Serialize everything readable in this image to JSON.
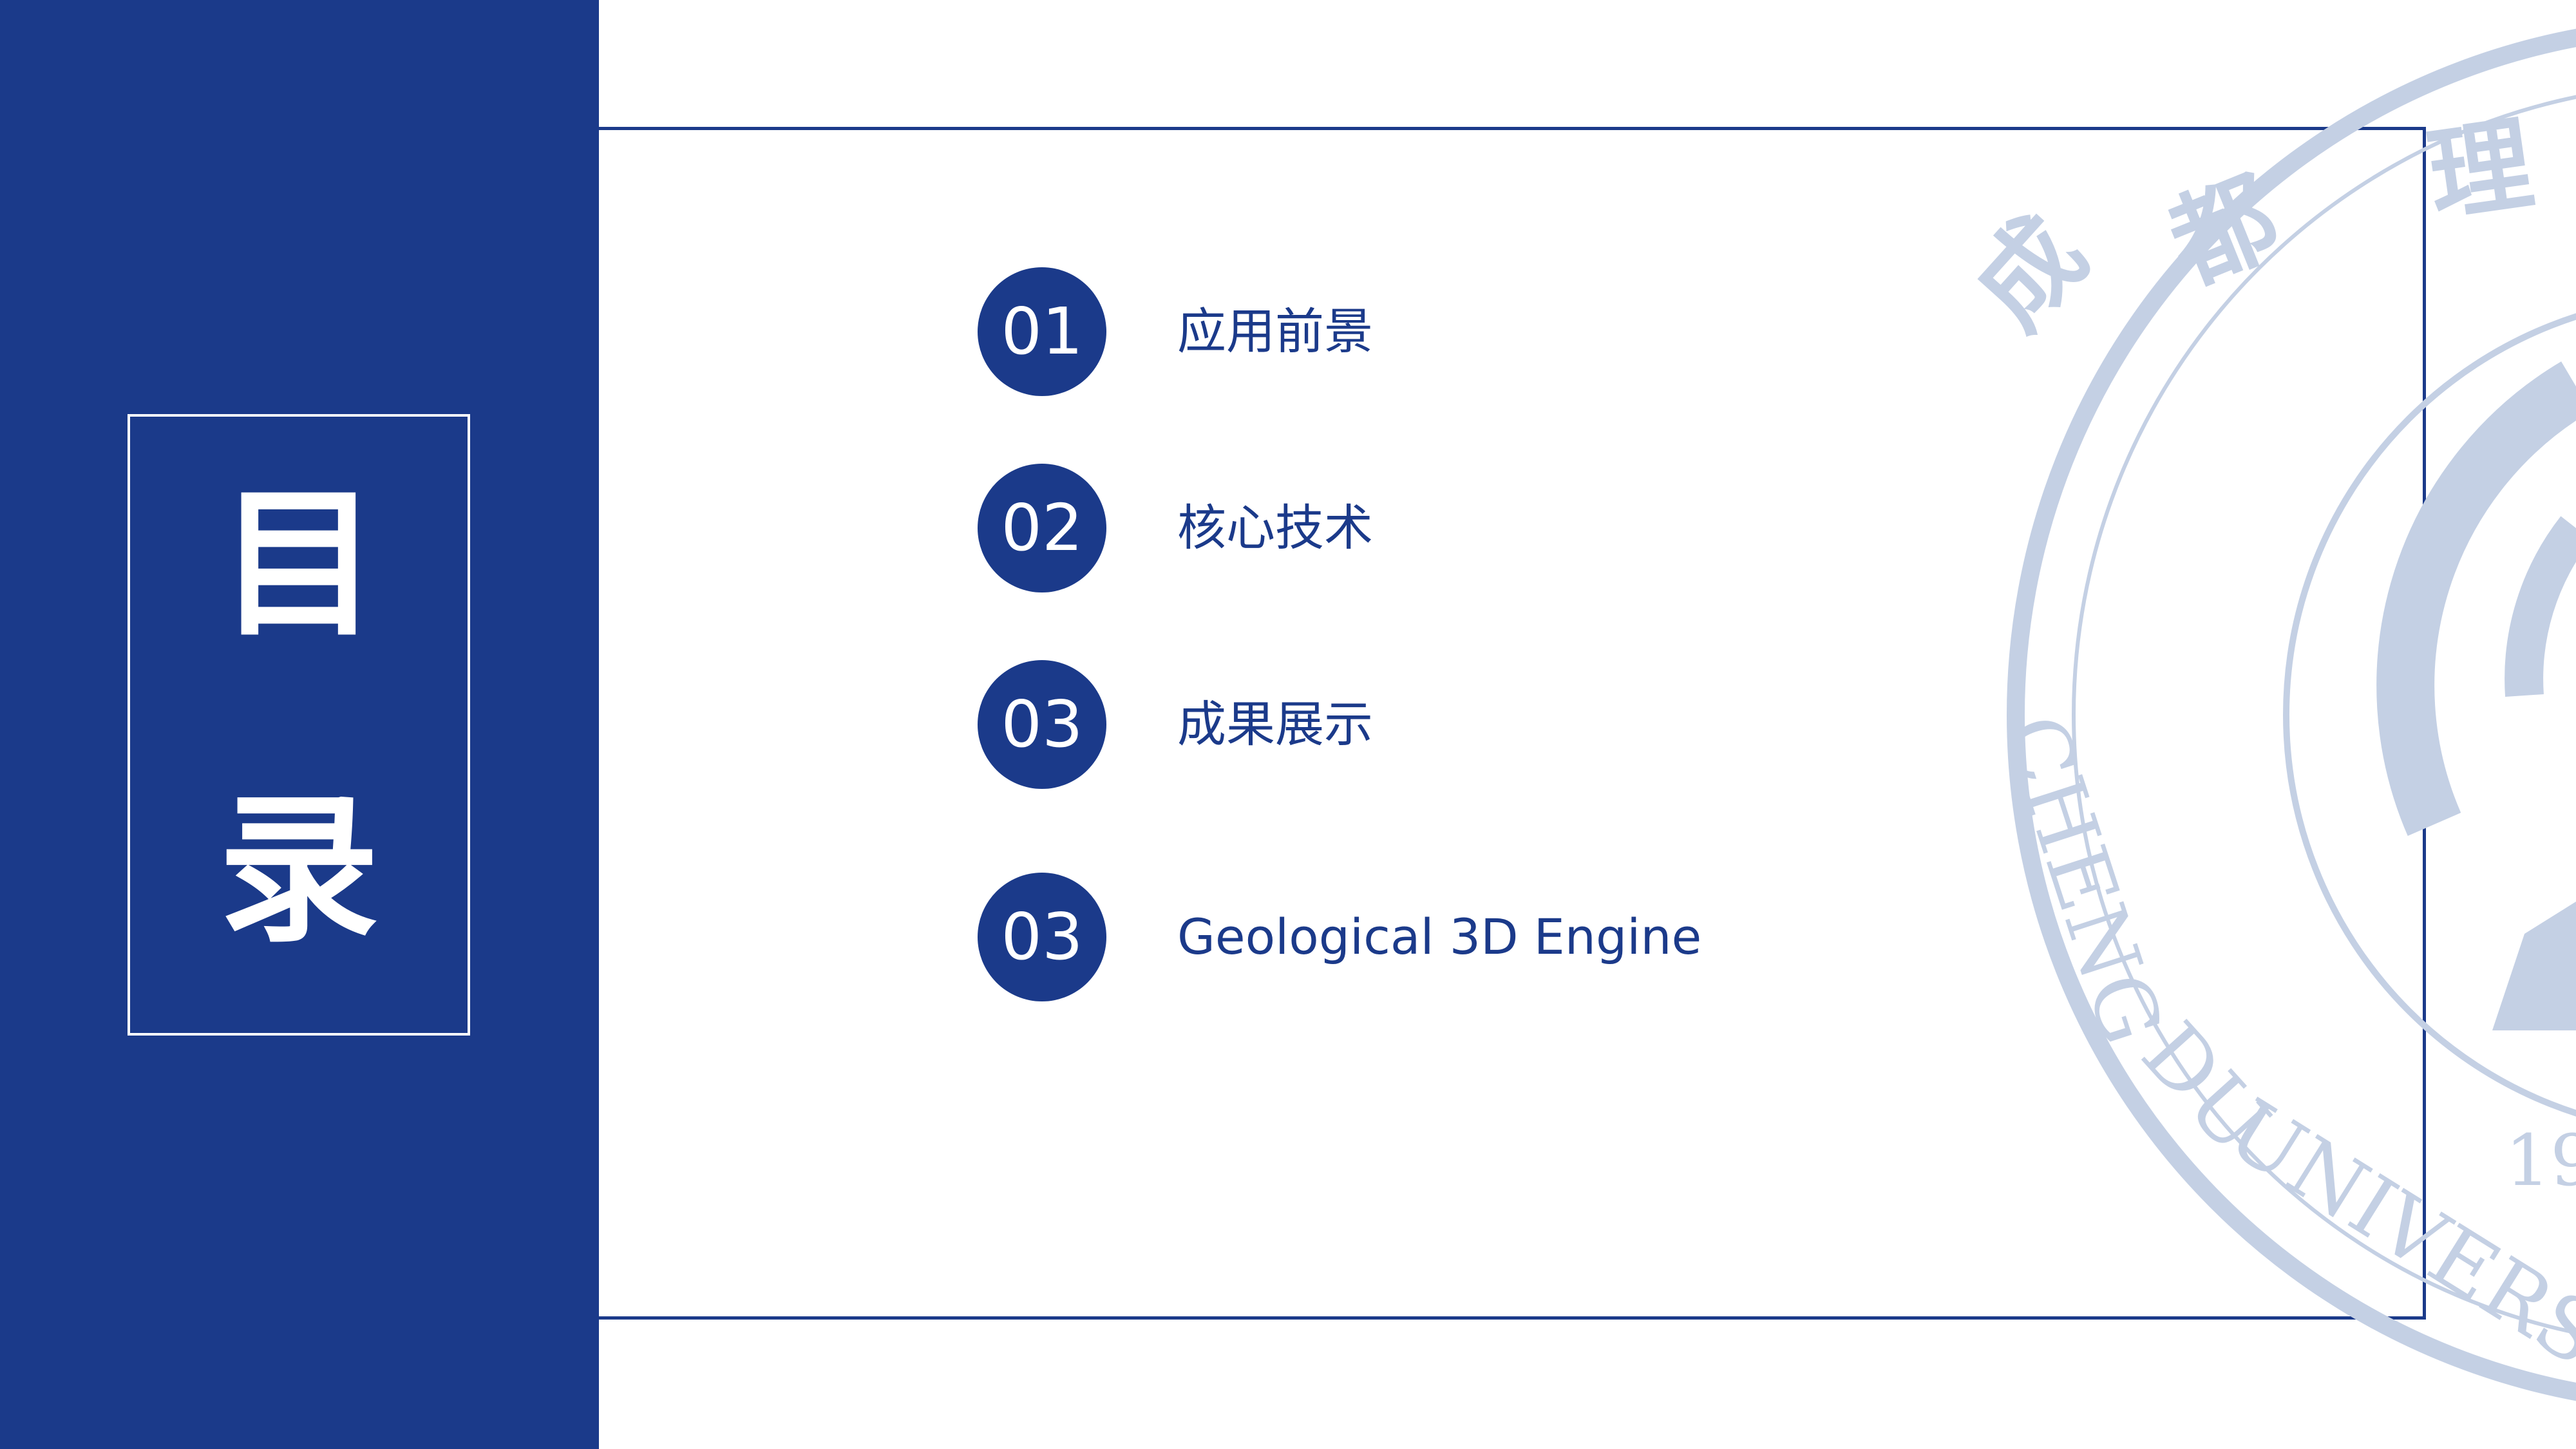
{
  "sidebar": {
    "title_char_1": "目",
    "title_char_2": "录"
  },
  "toc": {
    "items": [
      {
        "number": "01",
        "label": "应用前景"
      },
      {
        "number": "02",
        "label": "核心技术"
      },
      {
        "number": "03",
        "label": "成果展示"
      },
      {
        "number": "03",
        "label": "Geological 3D Engine"
      }
    ]
  },
  "watermark": {
    "top_text": "成都理",
    "ring_text": "CHENGDU UNIVERS",
    "year_partial": "19"
  },
  "colors": {
    "brand_blue": "#1b3a8a",
    "watermark_blue": "#c4d0e4",
    "background": "#ffffff"
  }
}
